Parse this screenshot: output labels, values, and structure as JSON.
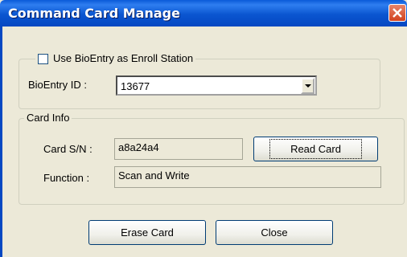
{
  "window": {
    "title": "Command Card Manage",
    "close_icon": "close-x-icon"
  },
  "enroll_group": {
    "checkbox_label": "Use BioEntry as Enroll Station",
    "checked": false,
    "bioentry_id_label": "BioEntry ID :",
    "bioentry_id_value": "13677"
  },
  "card_info": {
    "legend": "Card Info",
    "card_sn_label": "Card S/N :",
    "card_sn_value": "a8a24a4",
    "read_card_label": "Read Card",
    "function_label": "Function :",
    "function_value": "Scan and Write"
  },
  "buttons": {
    "erase_card": "Erase Card",
    "close": "Close"
  },
  "colors": {
    "titlebar": "#0a55d0",
    "dialog_bg": "#ece9d8",
    "close_button": "#d2421e"
  }
}
